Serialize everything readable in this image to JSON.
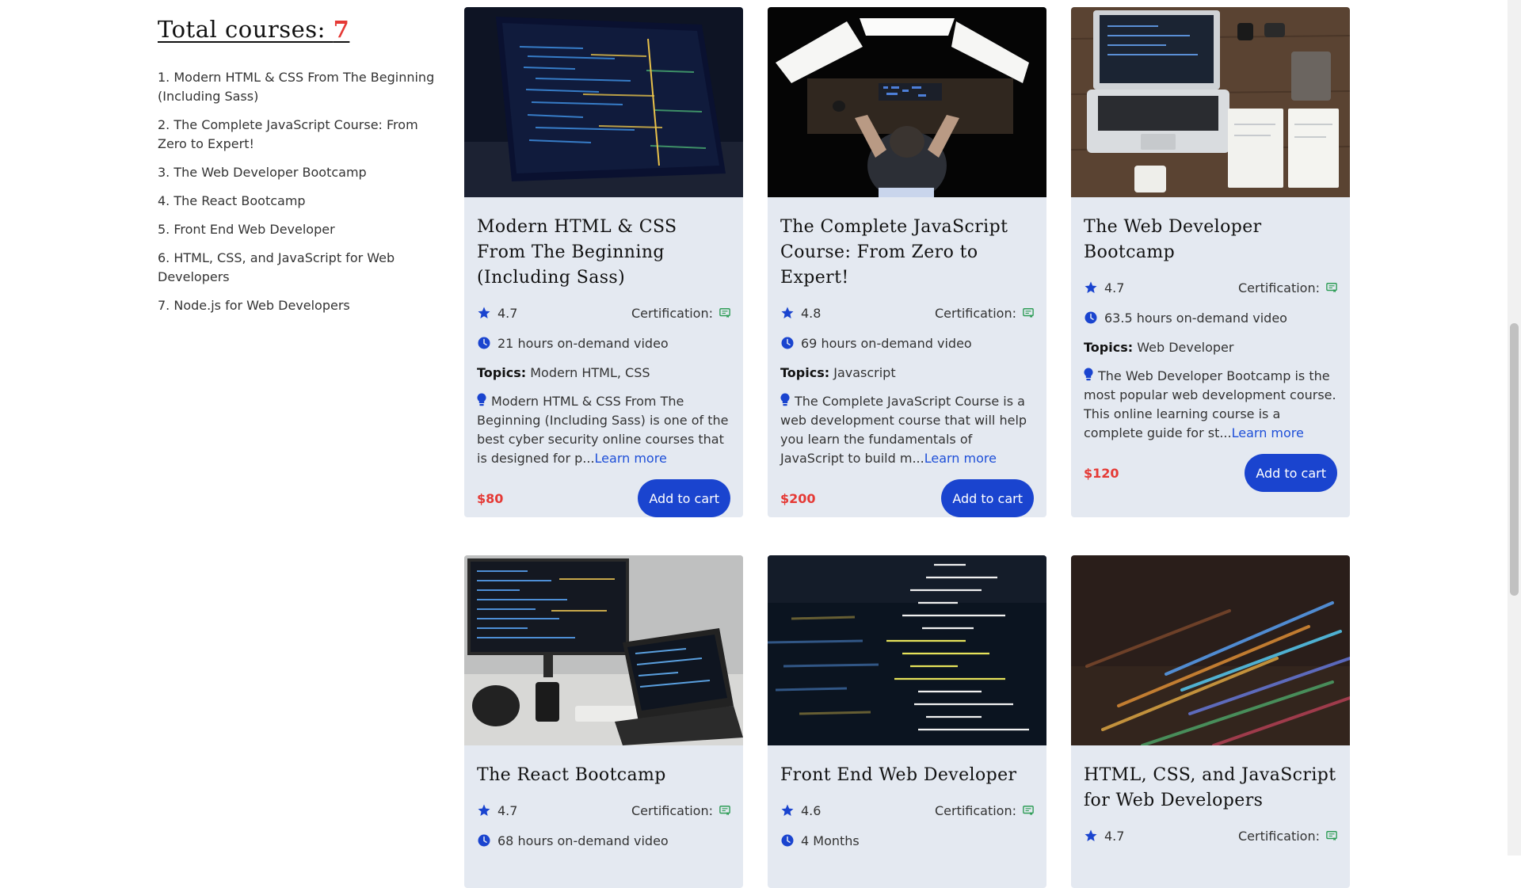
{
  "sidebar": {
    "total_label": "Total courses: ",
    "total_count": "7",
    "courses": [
      "1. Modern HTML & CSS From The Beginning (Including Sass)",
      "2. The Complete JavaScript Course: From Zero to Expert!",
      "3. The Web Developer Bootcamp",
      "4. The React Bootcamp",
      "5. Front End Web Developer",
      "6. HTML, CSS, and JavaScript for Web Developers",
      "7. Node.js for Web Developers"
    ]
  },
  "labels": {
    "certification": "Certification:",
    "topics": "Topics:",
    "learn_more": "Learn more",
    "add_to_cart": "Add to cart"
  },
  "cards": [
    {
      "title": "Modern HTML & CSS From The Beginning (Including Sass)",
      "rating": "4.7",
      "hours": "21 hours on-demand video",
      "topics": "Modern HTML, CSS",
      "description": "Modern HTML & CSS From The Beginning (Including Sass) is one of the best cyber security online courses that is designed for p...",
      "price": "$80"
    },
    {
      "title": "The Complete JavaScript Course: From Zero to Expert!",
      "rating": "4.8",
      "hours": "69 hours on-demand video",
      "topics": "Javascript",
      "description": "The Complete JavaScript Course is a web development course that will help you learn the fundamentals of JavaScript to build m...",
      "price": "$200"
    },
    {
      "title": "The Web Developer Bootcamp",
      "rating": "4.7",
      "hours": "63.5 hours on-demand video",
      "topics": "Web Developer",
      "description": "The Web Developer Bootcamp is the most popular web development course. This online learning course is a complete guide for st...",
      "price": "$120"
    },
    {
      "title": "The React Bootcamp",
      "rating": "4.7",
      "hours": "68 hours on-demand video"
    },
    {
      "title": "Front End Web Developer",
      "rating": "4.6",
      "hours": "4 Months"
    },
    {
      "title": "HTML, CSS, and JavaScript for Web Developers",
      "rating": "4.7"
    }
  ],
  "colors": {
    "accent": "#1a44cf",
    "price": "#e53935",
    "card_bg": "#e4e9f1",
    "certification_icon": "#2e9d57"
  },
  "icons": {
    "rating": "star-icon",
    "duration": "clock-icon",
    "description": "lightbulb-icon",
    "certification": "certificate-icon"
  }
}
